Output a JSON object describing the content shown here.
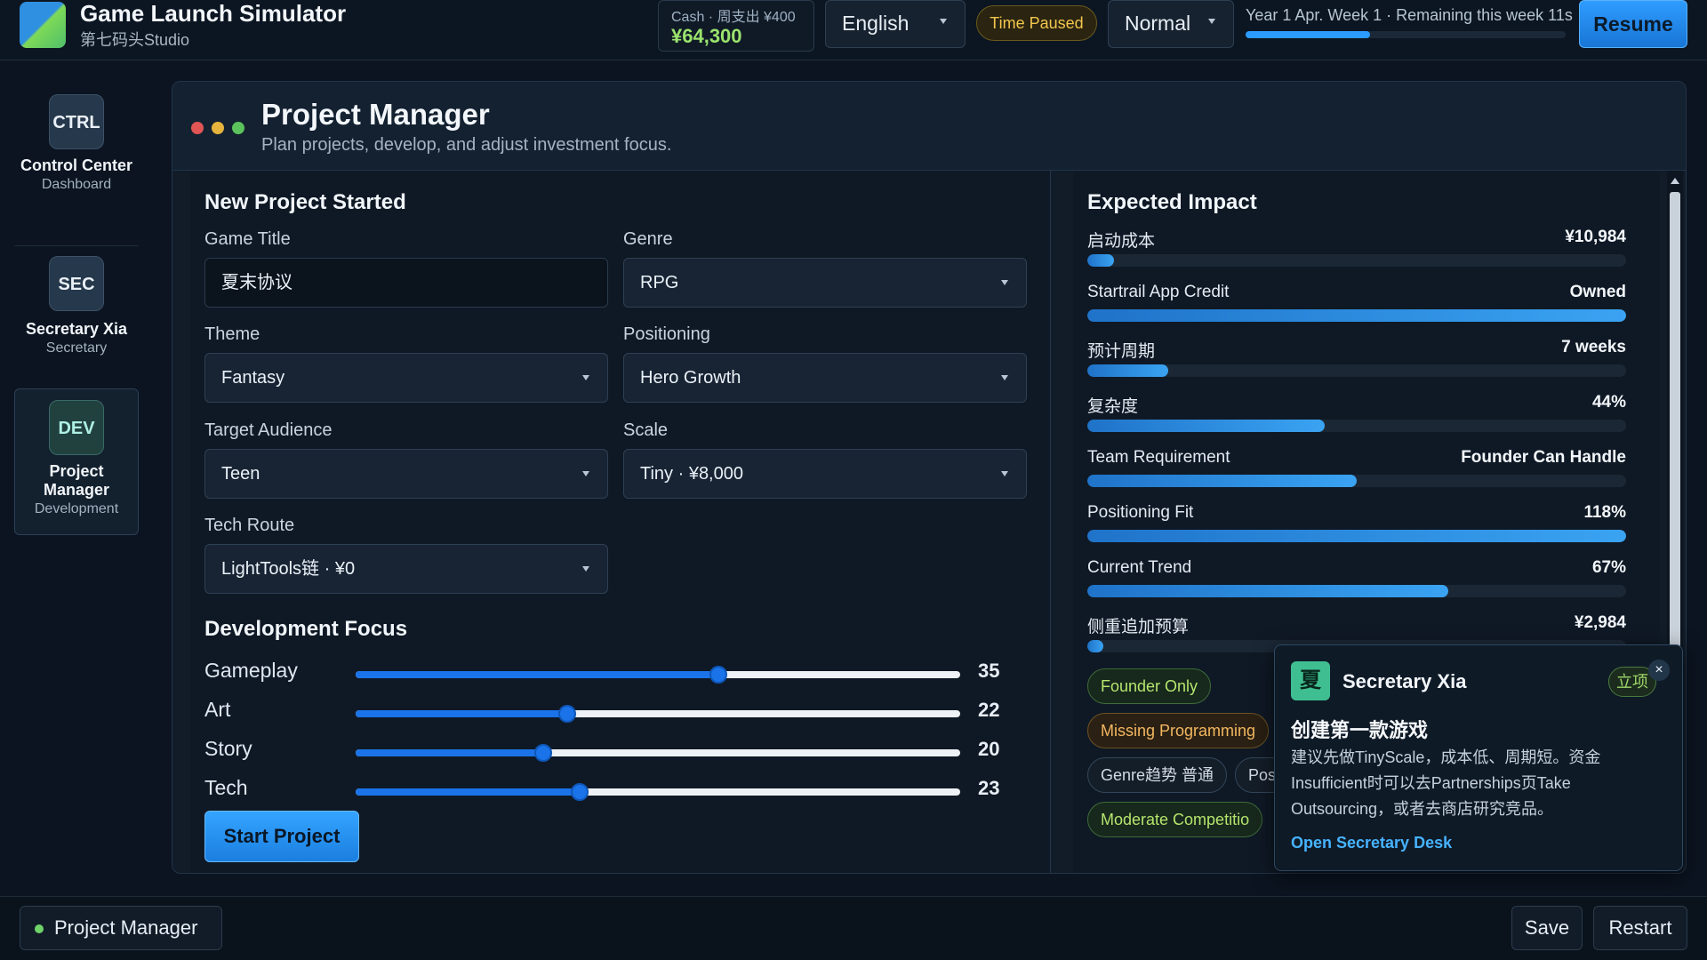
{
  "header": {
    "app_title": "Game Launch Simulator",
    "studio_name": "第七码头Studio",
    "cash_label": "Cash · 周支出 ¥400",
    "cash_value": "¥64,300",
    "language": "English",
    "time_status": "Time Paused",
    "speed": "Normal",
    "time_text": "Year 1 Apr. Week 1 · Remaining this week 11s",
    "week_progress": 0.39,
    "resume_label": "Resume"
  },
  "sidebar": {
    "items": [
      {
        "badge": "CTRL",
        "name": "Control Center",
        "role": "Dashboard"
      },
      {
        "badge": "SEC",
        "name": "Secretary Xia",
        "role": "Secretary"
      },
      {
        "badge": "DEV",
        "name": "Project Manager",
        "role": "Development"
      }
    ]
  },
  "panel": {
    "title": "Project Manager",
    "subtitle": "Plan projects, develop, and adjust investment focus."
  },
  "new_project": {
    "title": "New Project Started",
    "game_title_label": "Game Title",
    "game_title_value": "夏末协议",
    "genre_label": "Genre",
    "genre_value": "RPG",
    "theme_label": "Theme",
    "theme_value": "Fantasy",
    "positioning_label": "Positioning",
    "positioning_value": "Hero Growth",
    "audience_label": "Target Audience",
    "audience_value": "Teen",
    "scale_label": "Scale",
    "scale_value": "Tiny · ¥8,000",
    "tech_label": "Tech Route",
    "tech_value": "LightTools链 · ¥0"
  },
  "focus": {
    "title": "Development Focus",
    "sliders": [
      {
        "label": "Gameplay",
        "value": 35,
        "fill": 0.6
      },
      {
        "label": "Art",
        "value": 22,
        "fill": 0.35
      },
      {
        "label": "Story",
        "value": 20,
        "fill": 0.31
      },
      {
        "label": "Tech",
        "value": 23,
        "fill": 0.37
      }
    ],
    "start_label": "Start Project"
  },
  "impact": {
    "title": "Expected Impact",
    "metrics": [
      {
        "name": "启动成本",
        "value": "¥10,984",
        "fill": 0.05
      },
      {
        "name": "Startrail App Credit",
        "value": "Owned",
        "fill": 1.0
      },
      {
        "name": "预计周期",
        "value": "7 weeks",
        "fill": 0.15
      },
      {
        "name": "复杂度",
        "value": "44%",
        "fill": 0.44
      },
      {
        "name": "Team Requirement",
        "value": "Founder Can Handle",
        "fill": 0.5
      },
      {
        "name": "Positioning Fit",
        "value": "118%",
        "fill": 1.0
      },
      {
        "name": "Current Trend",
        "value": "67%",
        "fill": 0.67
      },
      {
        "name": "侧重追加预算",
        "value": "¥2,984",
        "fill": 0.03
      }
    ],
    "tags": {
      "founder_only": "Founder Only",
      "missing_programming": "Missing Programming",
      "genre_trend": "Genre趋势 普通",
      "positioning_short": "Pos",
      "moderate_competition": "Moderate Competitio"
    }
  },
  "popup": {
    "avatar": "夏",
    "name": "Secretary Xia",
    "tag": "立项",
    "close": "×",
    "heading": "创建第一款游戏",
    "body": "建议先做TinyScale，成本低、周期短。资金Insufficient时可以去Partnerships页Take Outsourcing，或者去商店研究竞品。",
    "link": "Open Secretary Desk"
  },
  "footer": {
    "current_view": "Project Manager",
    "save_label": "Save",
    "restart_label": "Restart"
  },
  "colors": {
    "accent": "#2b9bff",
    "cash": "#9be36d",
    "paused": "#f3c64e",
    "traffic_red": "#e25555",
    "traffic_yellow": "#e6b43c",
    "traffic_green": "#5cc25c"
  }
}
